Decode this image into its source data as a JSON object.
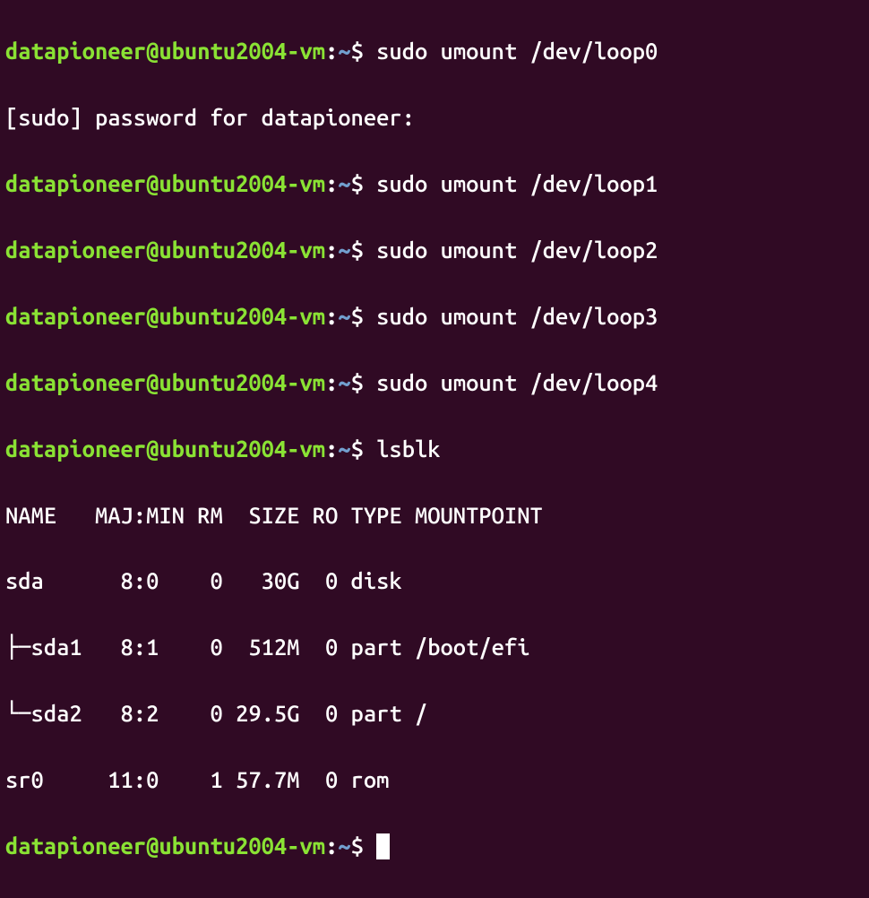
{
  "prompt": {
    "user": "datapioneer",
    "at": "@",
    "host": "ubuntu2004-vm",
    "colon": ":",
    "path": "~",
    "dollar": "$ "
  },
  "commands": {
    "c0": "sudo umount /dev/loop0",
    "c1": "sudo umount /dev/loop1",
    "c2": "sudo umount /dev/loop2",
    "c3": "sudo umount /dev/loop3",
    "c4": "sudo umount /dev/loop4",
    "c5": "lsblk",
    "c6": ""
  },
  "sudo_prompt": "[sudo] password for datapioneer: ",
  "lsblk": {
    "header": "NAME   MAJ:MIN RM  SIZE RO TYPE MOUNTPOINT",
    "rows": {
      "r0": "sda      8:0    0   30G  0 disk ",
      "r1": "├─sda1   8:1    0  512M  0 part /boot/efi",
      "r2": "└─sda2   8:2    0 29.5G  0 part /",
      "r3": "sr0     11:0    1 57.7M  0 rom  "
    }
  }
}
